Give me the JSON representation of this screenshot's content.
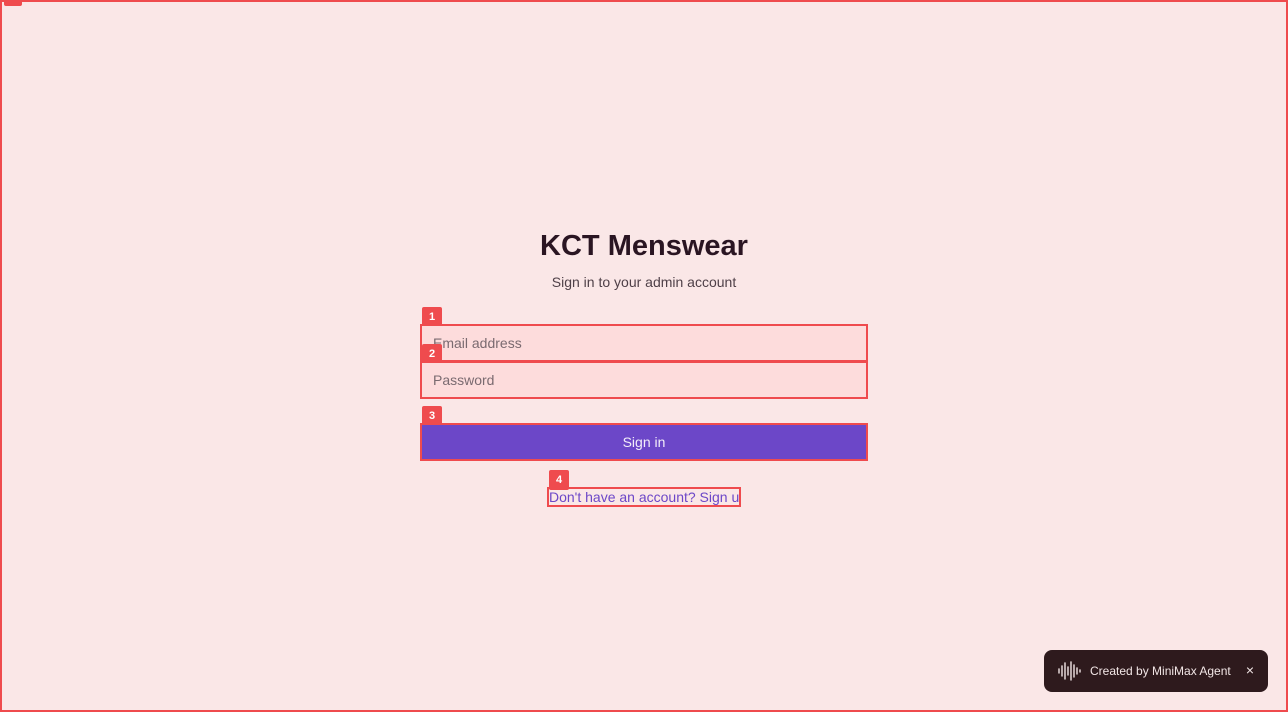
{
  "login": {
    "title": "KCT Menswear",
    "subtitle": "Sign in to your admin account",
    "email_placeholder": "Email address",
    "password_placeholder": "Password",
    "signin_label": "Sign in",
    "signup_link": "Don't have an account? Sign up"
  },
  "markers": {
    "m1": "1",
    "m2": "2",
    "m3": "3",
    "m4": "4"
  },
  "toast": {
    "text": "Created by MiniMax Agent",
    "close_glyph": "×",
    "icon": "waveform-icon"
  },
  "colors": {
    "background": "#fae7e7",
    "accent": "#6c47c8",
    "highlight": "#ef4b4e",
    "toast_background": "#2e1a1d"
  }
}
